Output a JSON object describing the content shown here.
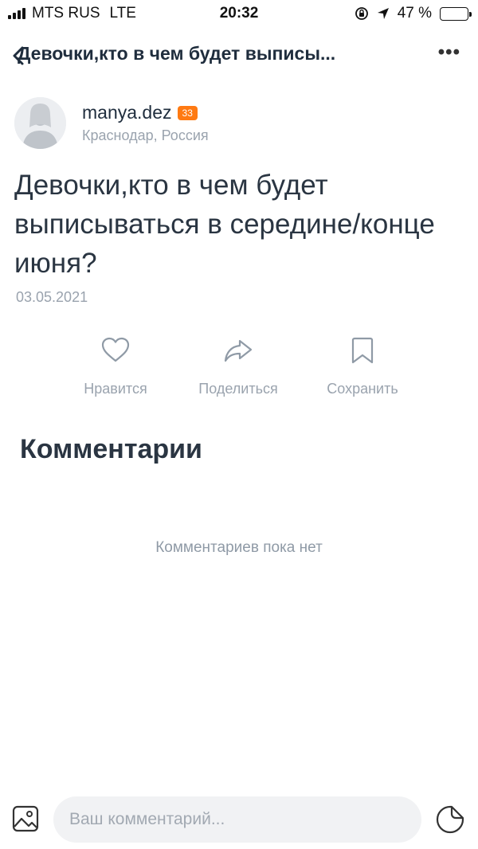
{
  "status_bar": {
    "carrier": "MTS RUS",
    "network": "LTE",
    "time": "20:32",
    "battery_percent": "47 %",
    "battery_level": 0.47
  },
  "nav": {
    "title": "Девочки,кто в чем будет выписы...",
    "back_icon": "back-arrow-icon",
    "more_icon": "more-dots-icon",
    "more_label": "•••"
  },
  "author": {
    "username": "manya.dez",
    "badge": "33",
    "location": "Краснодар, Россия",
    "avatar_icon": "default-avatar-icon"
  },
  "post": {
    "title": "Девочки,кто в чем будет выписываться в середине/конце июня?",
    "date": "03.05.2021"
  },
  "actions": {
    "like_label": "Нравится",
    "share_label": "Поделиться",
    "save_label": "Сохранить"
  },
  "comments": {
    "heading": "Комментарии",
    "empty_text": "Комментариев пока нет"
  },
  "composer": {
    "placeholder": "Ваш комментарий...",
    "value": ""
  },
  "colors": {
    "accent_badge": "#ff7a12",
    "icon_gray": "#8f9aa6",
    "text_dark": "#2a3542"
  }
}
